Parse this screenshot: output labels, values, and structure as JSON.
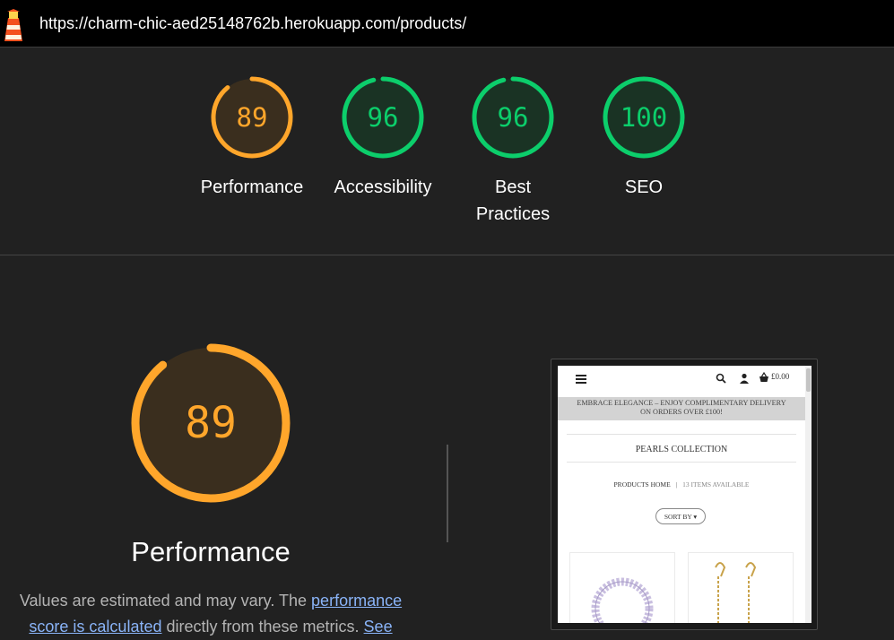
{
  "browser": {
    "url": "https://charm-chic-aed25148762b.herokuapp.com/products/"
  },
  "summary": [
    {
      "score": "89",
      "label": "Performance",
      "color": "#ffa62b",
      "fill": "#3a2e1e",
      "fraction": 0.89
    },
    {
      "score": "96",
      "label": "Accessibility",
      "color": "#0cce6b",
      "fill": "#1a3324",
      "fraction": 0.96
    },
    {
      "score": "96",
      "label_lines": [
        "Best",
        "Practices"
      ],
      "color": "#0cce6b",
      "fill": "#1a3324",
      "fraction": 0.96
    },
    {
      "score": "100",
      "label": "SEO",
      "color": "#0cce6b",
      "fill": "#1a3324",
      "fraction": 1.0
    }
  ],
  "performance": {
    "score": "89",
    "fraction": 0.89,
    "title": "Performance",
    "desc_prefix": "Values are estimated and may vary. The ",
    "desc_link": "performance score is calculated",
    "desc_middle": " directly from these metrics. ",
    "desc_link2": "See"
  },
  "thumbnail": {
    "cart_total": "£0.00",
    "banner_line1": "EMBRACE ELEGANCE – ENJOY COMPLIMENTARY DELIVERY",
    "banner_line2": "ON ORDERS OVER £100!",
    "heading": "PEARLS COLLECTION",
    "crumb_home": "PRODUCTS HOME",
    "crumb_sep": "|",
    "crumb_count": "13 ITEMS AVAILABLE",
    "sort_label": "SORT BY ▾"
  },
  "icons": {
    "logo": "lighthouse-icon",
    "menu": "hamburger-menu-icon",
    "search": "search-icon",
    "user": "user-icon",
    "basket": "basket-icon"
  }
}
